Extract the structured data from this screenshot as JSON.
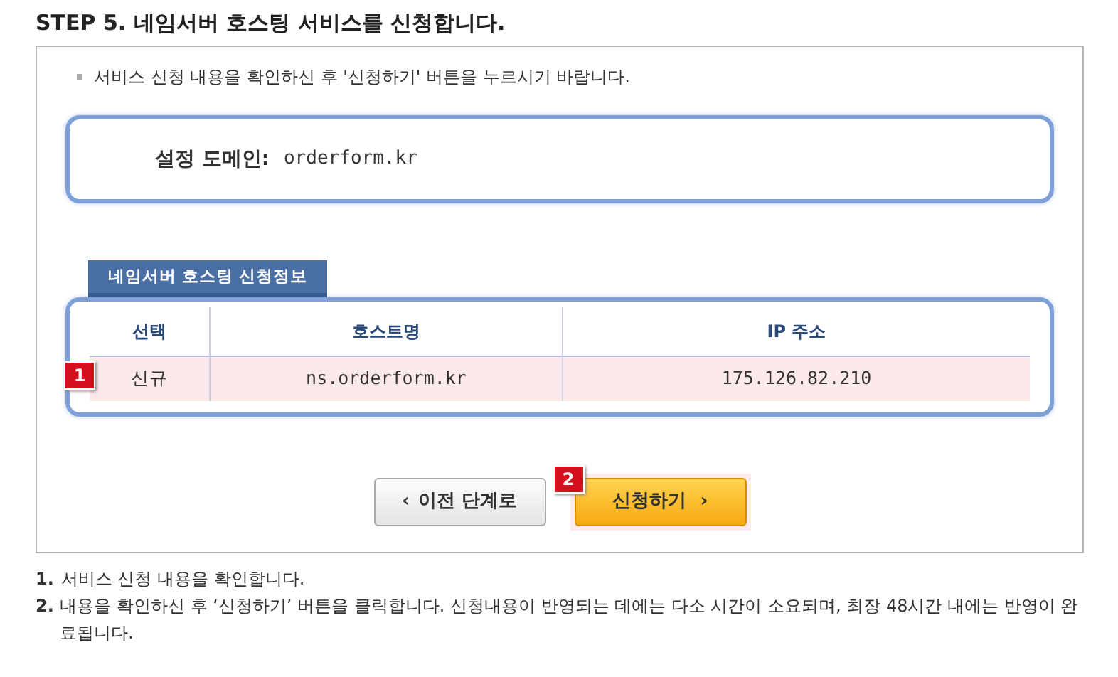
{
  "title": "**STEP 5.** 네임서버 호스팅 서비스를 신청합니다.",
  "notice": "서비스 신청 내용을 확인하신 후 '신청하기' 버튼을 누르시기 바랍니다.",
  "domain": {
    "label": "설정 도메인:",
    "value": "orderform.kr"
  },
  "section_title": "네임서버 호스팅 신청정보",
  "table": {
    "columns": [
      "선택",
      "호스트명",
      "IP 주소"
    ],
    "rows": [
      {
        "marker": "1",
        "cells": [
          "신규",
          "ns.orderform.kr",
          "175.126.82.210"
        ]
      }
    ]
  },
  "buttons": [
    {
      "kind": "prev",
      "label": "이전 단계로",
      "icon": "‹"
    },
    {
      "kind": "submit",
      "label": "신청하기",
      "icon": "›",
      "marker": "2"
    }
  ],
  "notes": [
    {
      "number": "1.",
      "text": "서비스 신청 내용을 확인합니다."
    },
    {
      "number": "2.",
      "text": "내용을 확인하신 후 ‘신청하기’ 버튼을 클릭합니다. 신청내용이 반영되는 데에는 다소 시간이 소요되며, 최장 48시간 내에는 반영이 완료됩니다."
    }
  ]
}
